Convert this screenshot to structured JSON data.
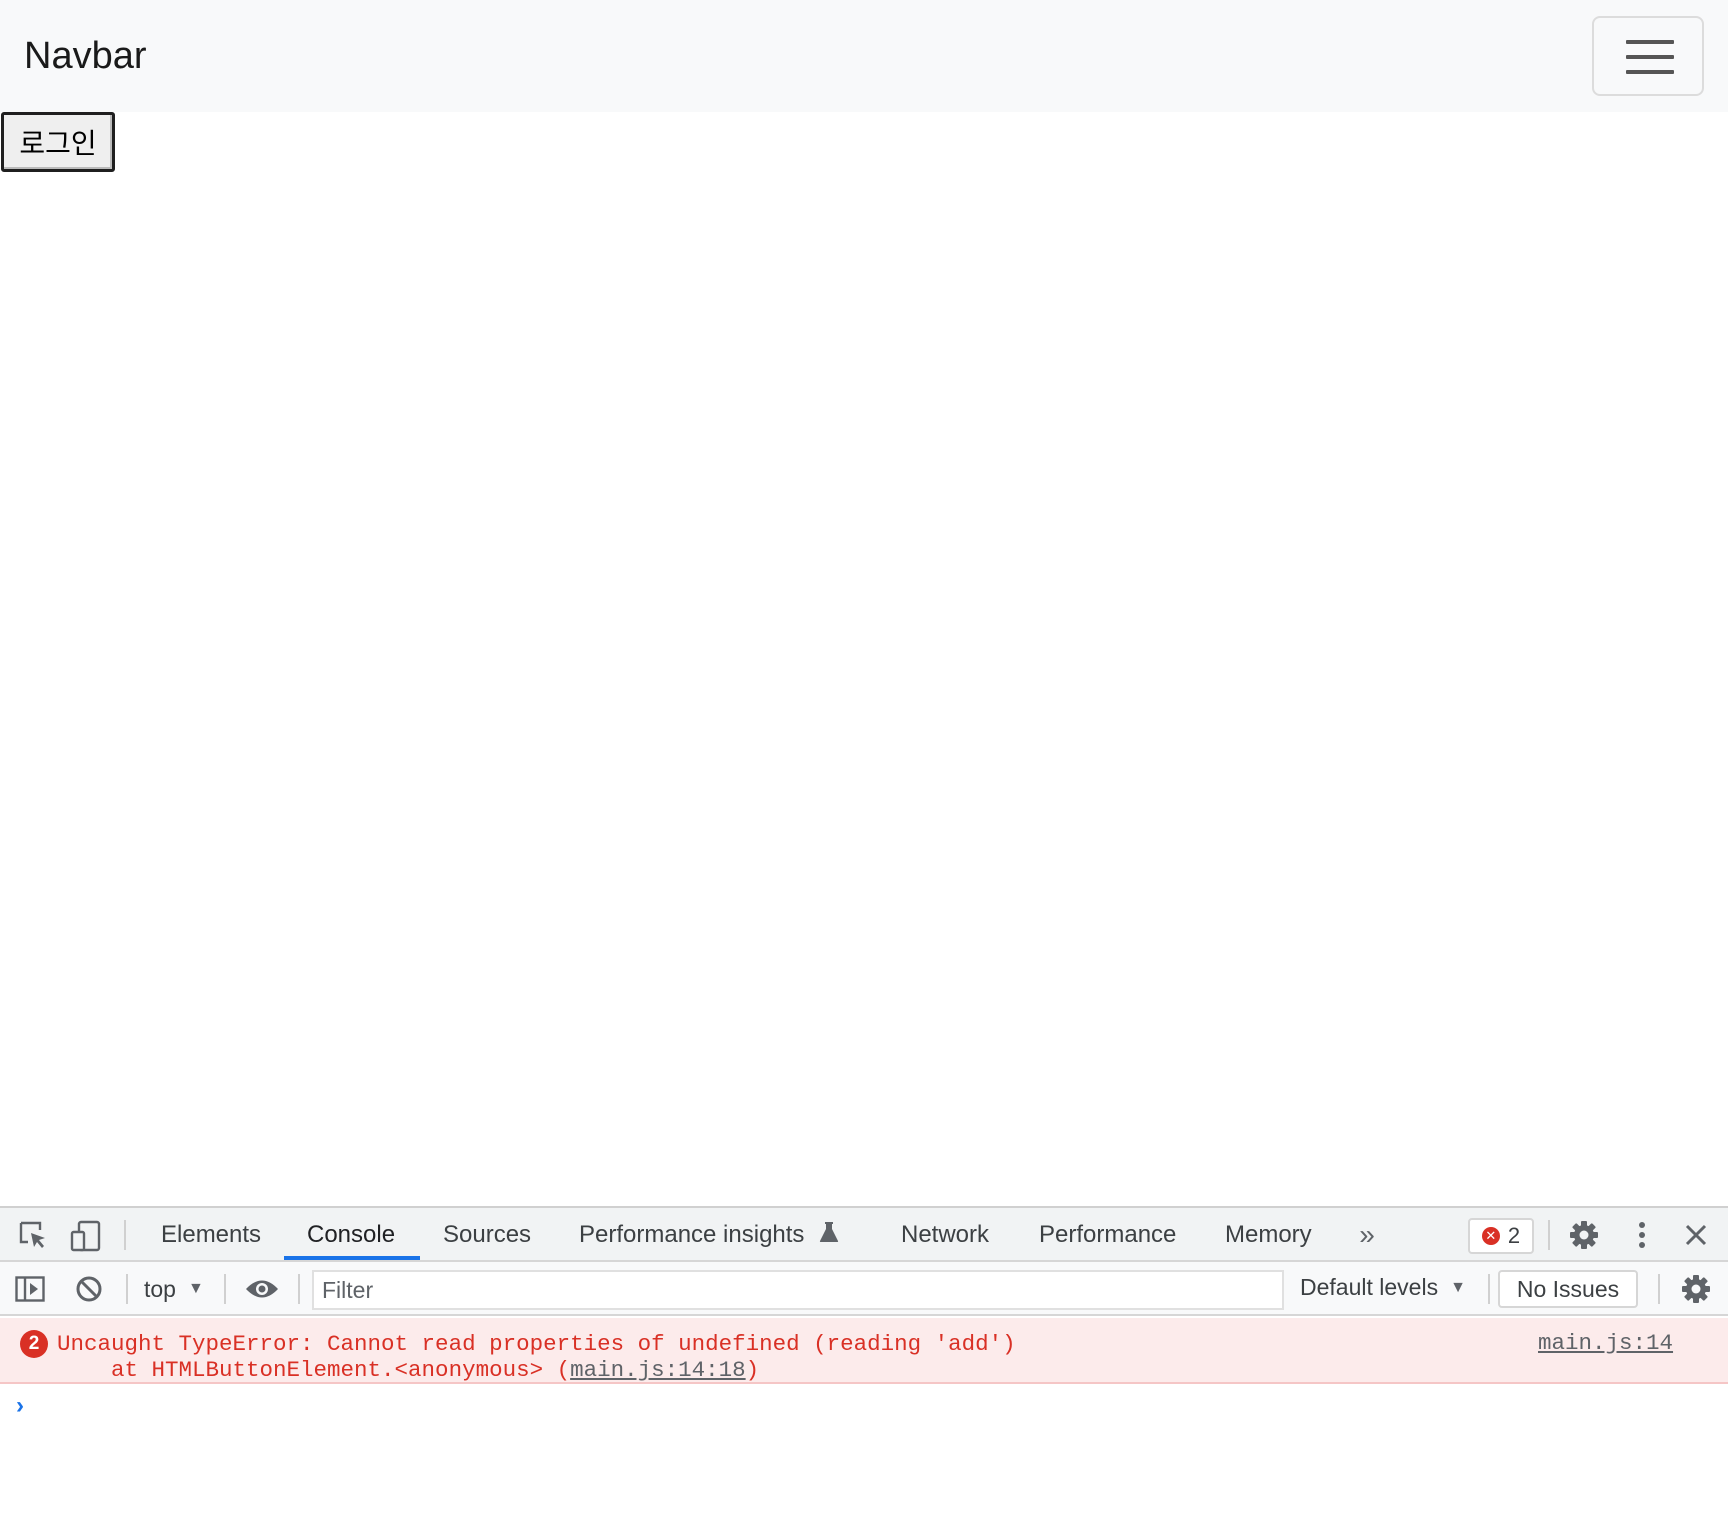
{
  "navbar": {
    "brand": "Navbar",
    "toggler_icon": "hamburger-icon"
  },
  "main": {
    "login_label": "로그인"
  },
  "devtools": {
    "icons": {
      "inspect": "inspect-element-icon",
      "device": "device-toolbar-icon",
      "more_tabs": "double-chevron-icon",
      "settings": "gear-icon",
      "menu": "kebab-menu-icon",
      "close": "close-icon",
      "sidebar": "sidebar-toggle-icon",
      "clear": "clear-console-icon",
      "eye": "eye-icon",
      "flask": "flask-icon",
      "console_settings": "gear-icon"
    },
    "tabs": [
      {
        "label": "Elements"
      },
      {
        "label": "Console",
        "active": true
      },
      {
        "label": "Sources"
      },
      {
        "label": "Performance insights"
      },
      {
        "label": "Network"
      },
      {
        "label": "Performance"
      },
      {
        "label": "Memory"
      }
    ],
    "error_badge_count": "2",
    "toolbar": {
      "context": "top",
      "filter_placeholder": "Filter",
      "levels": "Default levels",
      "issues": "No Issues"
    },
    "console": {
      "error_count": "2",
      "error_message": "Uncaught TypeError: Cannot read properties of undefined (reading 'add')",
      "stack_prefix": "    at HTMLButtonElement.<anonymous> (",
      "stack_link": "main.js:14:18",
      "stack_suffix": ")",
      "source": "main.js:14",
      "prompt": "›"
    },
    "colors": {
      "error": "#d93025",
      "active_tab": "#1a73e8",
      "error_row_bg": "#fcebeb"
    }
  }
}
